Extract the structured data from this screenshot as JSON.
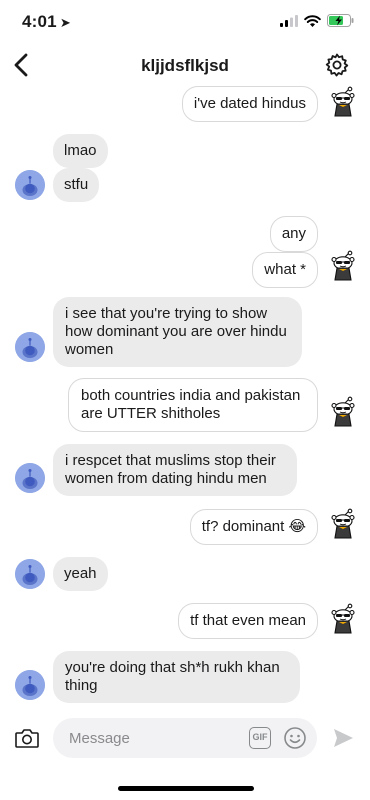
{
  "status_bar": {
    "time": "4:01",
    "location_icon": "location-arrow-icon",
    "signal_icon": "cellular-signal-icon",
    "wifi_icon": "wifi-icon",
    "battery_icon": "battery-charging-icon"
  },
  "header": {
    "title": "kljjdsflkjsd",
    "back_icon": "chevron-left-icon",
    "settings_icon": "gear-icon"
  },
  "messages": [
    {
      "from": "me",
      "text": "i've dated hindus"
    },
    {
      "from": "them",
      "text": "lmao"
    },
    {
      "from": "them",
      "text": "stfu"
    },
    {
      "from": "me",
      "text": "any"
    },
    {
      "from": "me",
      "text": "what *"
    },
    {
      "from": "them",
      "text": "i see that you're trying to show how dominant you are over hindu women"
    },
    {
      "from": "me",
      "text": "both countries india and pakistan are UTTER shitholes"
    },
    {
      "from": "them",
      "text": "i respcet that muslims stop their women from dating hindu men"
    },
    {
      "from": "me",
      "text": "tf? dominant 😂"
    },
    {
      "from": "them",
      "text": "yeah"
    },
    {
      "from": "me",
      "text": "tf that even mean"
    },
    {
      "from": "them",
      "text": "you're doing that sh*h rukh khan thing"
    }
  ],
  "composer": {
    "placeholder": "Message",
    "gif_label": "GIF",
    "camera_icon": "camera-icon",
    "emoji_icon": "emoji-icon",
    "send_icon": "send-icon"
  },
  "colors": {
    "their_bubble": "#ebebeb",
    "my_bubble_border": "#d9d9d9",
    "their_avatar": "#8fa7e6"
  }
}
